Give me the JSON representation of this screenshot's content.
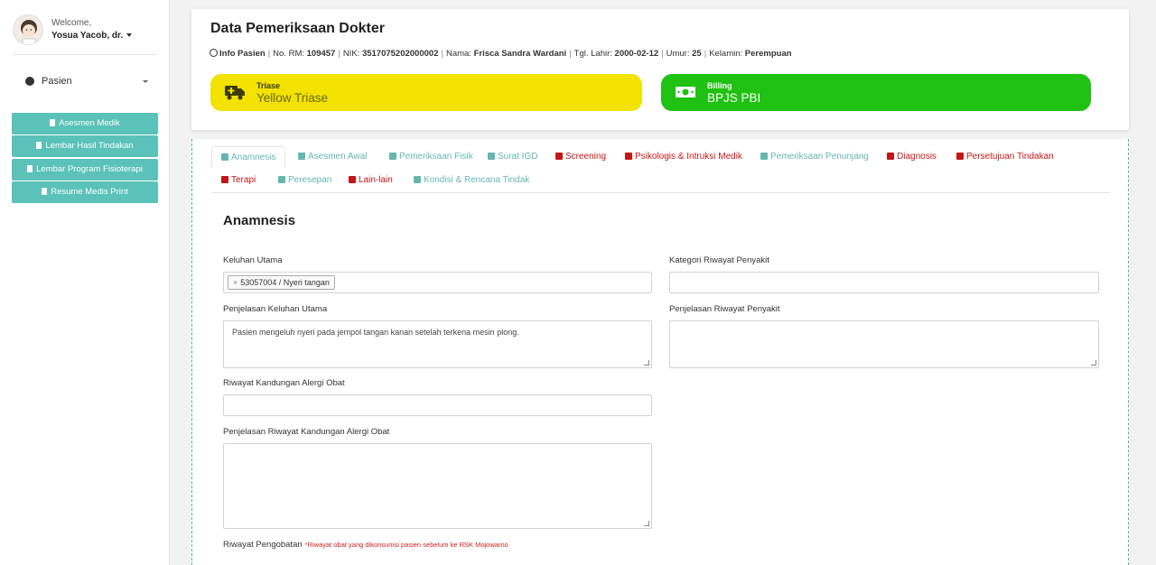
{
  "user": {
    "welcome": "Welcome,",
    "name": "Yosua Yacob, dr."
  },
  "sidebar": {
    "menu_label": "Pasien",
    "buttons": [
      "Asesmen Medik",
      "Lembar Hasil Tindakan",
      "Lembar Program Fisioterapi",
      "Resume Medis Print"
    ]
  },
  "header": {
    "title": "Data Pemeriksaan Dokter",
    "info_label": "Info Pasien",
    "no_rm_label": "No. RM:",
    "no_rm": "109457",
    "nik_label": "NIK:",
    "nik": "3517075202000002",
    "nama_label": "Nama:",
    "nama": "Frisca Sandra Wardani",
    "tgl_lahir_label": "Tgl. Lahir:",
    "tgl_lahir": "2000-02-12",
    "umur_label": "Umur:",
    "umur": "25",
    "kelamin_label": "Kelamin:",
    "kelamin": "Perempuan",
    "triase": {
      "label": "Triase",
      "value": "Yellow Triase",
      "color": "#f3e100"
    },
    "billing": {
      "label": "Billing",
      "value": "BPJS PBI",
      "color": "#1fc112"
    }
  },
  "tabs": [
    {
      "label": "Anamnesis",
      "color": "teal",
      "active": true
    },
    {
      "label": "Asesmen Awal",
      "color": "teal"
    },
    {
      "label": "Pemeriksaan Fisik",
      "color": "teal"
    },
    {
      "label": "Surat IGD",
      "color": "teal"
    },
    {
      "label": "Screening",
      "color": "red"
    },
    {
      "label": "Psikologis & Intruksi Medik",
      "color": "red"
    },
    {
      "label": "Pemeriksaan Penunjang",
      "color": "teal"
    },
    {
      "label": "Diagnosis",
      "color": "red"
    },
    {
      "label": "Persetujuan Tindakan",
      "color": "red"
    },
    {
      "label": "Terapi",
      "color": "red"
    },
    {
      "label": "Peresepan",
      "color": "teal"
    },
    {
      "label": "Lain-lain",
      "color": "red"
    },
    {
      "label": "Kondisi & Rencana Tindak",
      "color": "teal"
    }
  ],
  "form": {
    "section_title": "Anamnesis",
    "keluhan_utama_label": "Keluhan Utama",
    "keluhan_utama_tag": "53057004 / Nyeri tangan",
    "kategori_label": "Kategori Riwayat Penyakit",
    "penjelasan_keluhan_label": "Penjelasan Keluhan Utama",
    "penjelasan_keluhan_value": "Pasien mengeluh nyeri pada jempol tangan kanan setelah terkena mesin plong.",
    "penjelasan_riwayat_label": "Penjelasan Riwayat Penyakit",
    "alergi_label": "Riwayat Kandungan Alergi Obat",
    "penjelasan_alergi_label": "Penjelasan Riwayat Kandungan Alergi Obat",
    "pengobatan_label": "Riwayat Pengobatan",
    "pengobatan_note": "*Riwayat obat yang dikonsumsi pasien sebelum ke RSK Mojowarno"
  }
}
